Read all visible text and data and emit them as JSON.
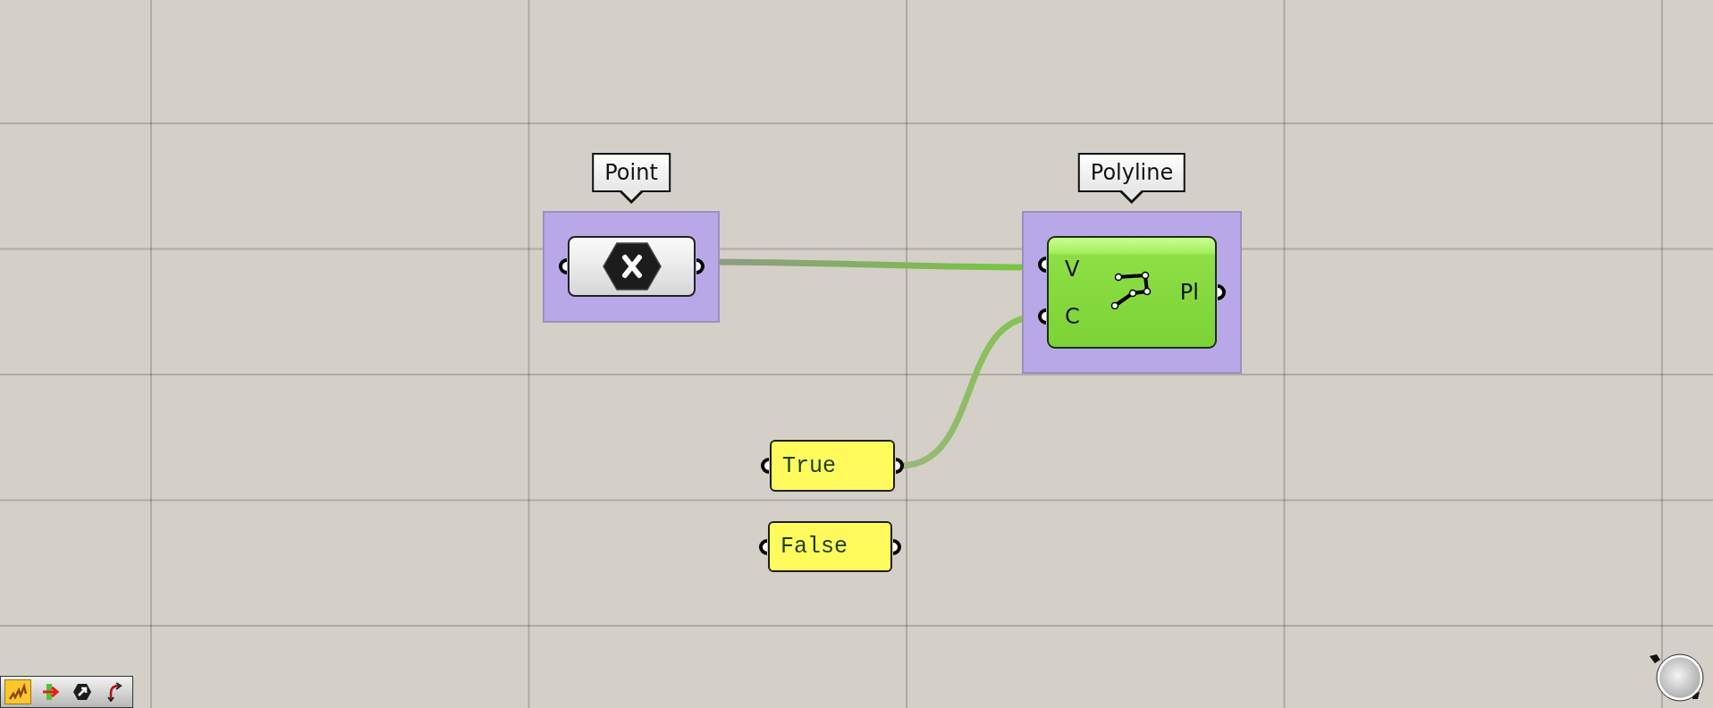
{
  "canvas": {
    "nodes": [
      {
        "kind": "param",
        "label": "Point"
      },
      {
        "kind": "component",
        "label": "Polyline",
        "inputs": [
          {
            "name": "V",
            "connected": true
          },
          {
            "name": "C",
            "connected": true
          }
        ],
        "outputs": [
          {
            "name": "Pl"
          }
        ]
      },
      {
        "kind": "panel",
        "value": "True"
      },
      {
        "kind": "panel",
        "value": "False"
      }
    ]
  },
  "toolbar": {
    "buttons": [
      {
        "selected": true
      },
      {
        "selected": false
      },
      {
        "selected": false
      },
      {
        "selected": false
      }
    ]
  }
}
